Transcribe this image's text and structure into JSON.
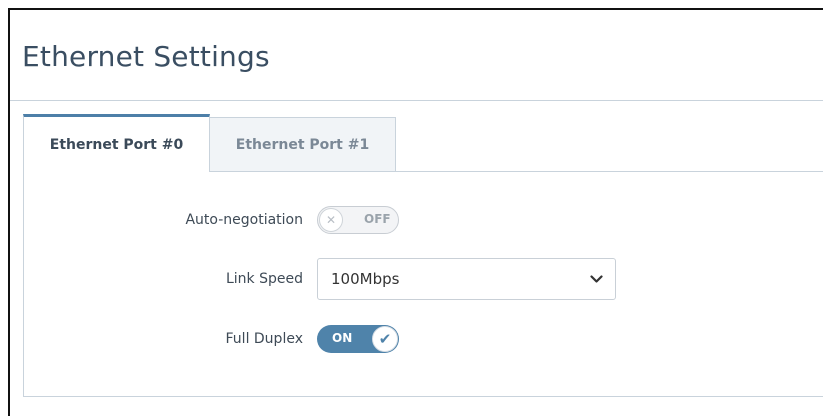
{
  "page": {
    "title": "Ethernet Settings"
  },
  "tabs": [
    {
      "label": "Ethernet Port #0",
      "active": true
    },
    {
      "label": "Ethernet Port #1",
      "active": false
    }
  ],
  "form": {
    "auto_negotiation": {
      "label": "Auto-negotiation",
      "state_text": "OFF",
      "enabled": false,
      "knob_icon": "x-icon"
    },
    "link_speed": {
      "label": "Link Speed",
      "value": "100Mbps",
      "icon": "chevron-down-icon"
    },
    "full_duplex": {
      "label": "Full Duplex",
      "state_text": "ON",
      "enabled": true,
      "knob_icon": "check-icon"
    }
  },
  "colors": {
    "accent": "#4f83aa",
    "title": "#3a4e62",
    "border": "#c9d3dc"
  }
}
